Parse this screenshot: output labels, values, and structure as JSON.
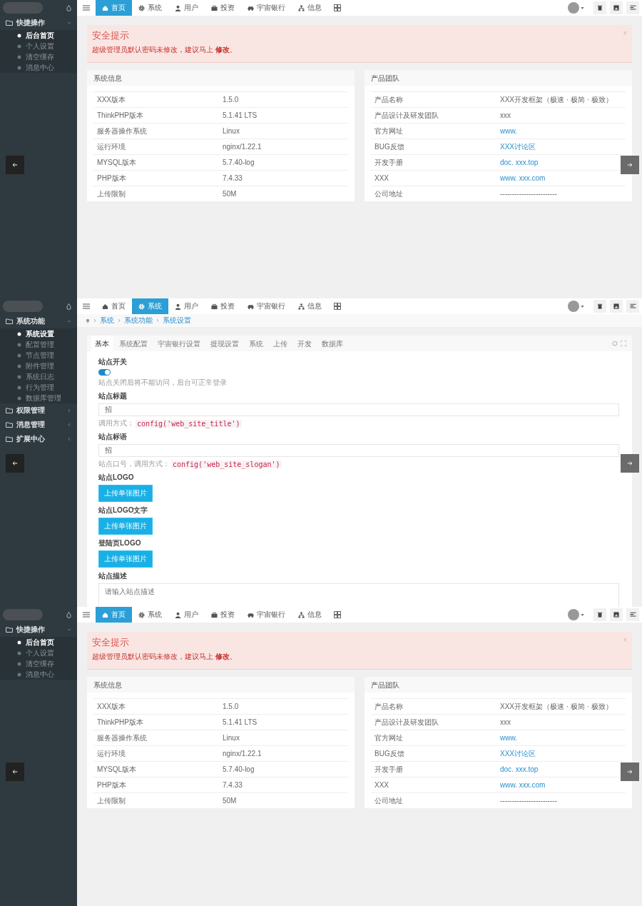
{
  "screens": [
    {
      "kind": "dashboard",
      "nav": [
        {
          "label": "首页",
          "selected": true
        },
        {
          "label": "系统",
          "selected": false
        },
        {
          "label": "用户",
          "selected": false
        },
        {
          "label": "投资",
          "selected": false
        },
        {
          "label": "宇宙银行",
          "selected": false
        },
        {
          "label": "信息",
          "selected": false
        }
      ],
      "sidebar": [
        {
          "label": "快捷操作",
          "expanded": true,
          "children": [
            {
              "label": "后台首页",
              "selected": true
            },
            {
              "label": "个人设置",
              "selected": false
            },
            {
              "label": "清空缓存",
              "selected": false
            },
            {
              "label": "消息中心",
              "selected": false
            }
          ]
        }
      ],
      "alert": {
        "title": "安全提示",
        "text": "超级管理员默认密码未修改，建议马上 **修改**。",
        "close": "×"
      },
      "panels": [
        {
          "title": "系统信息",
          "rows": [
            {
              "label": "XXX版本",
              "value": "1.5.0",
              "kind": "text"
            },
            {
              "label": "ThinkPHP版本",
              "value": "5.1.41 LTS",
              "kind": "text"
            },
            {
              "label": "服务器操作系统",
              "value": "Linux",
              "kind": "text"
            },
            {
              "label": "运行环境",
              "value": "nginx/1.22.1",
              "kind": "text"
            },
            {
              "label": "MYSQL版本",
              "value": "5.7.40-log",
              "kind": "text"
            },
            {
              "label": "PHP版本",
              "value": "7.4.33",
              "kind": "text"
            },
            {
              "label": "上传限制",
              "value": "50M",
              "kind": "text"
            }
          ]
        },
        {
          "title": "产品团队",
          "rows": [
            {
              "label": "产品名称",
              "value": "XXX开发框架（极速 · 极简 · 极致）",
              "kind": "text"
            },
            {
              "label": "产品设计及研发团队",
              "value": "xxx",
              "kind": "text"
            },
            {
              "label": "官方网址",
              "value": "www.",
              "kind": "link"
            },
            {
              "label": "BUG反馈",
              "value": "XXX讨论区",
              "kind": "link"
            },
            {
              "label": "开发手册",
              "value": "doc. xxx.top",
              "kind": "link"
            },
            {
              "label": "XXX",
              "value": "www. xxx.com",
              "kind": "link"
            },
            {
              "label": "公司地址",
              "value": "------------------------",
              "kind": "text"
            }
          ]
        }
      ]
    },
    {
      "kind": "settings",
      "nav": [
        {
          "label": "首页",
          "selected": false
        },
        {
          "label": "系统",
          "selected": true
        },
        {
          "label": "用户",
          "selected": false
        },
        {
          "label": "投资",
          "selected": false
        },
        {
          "label": "宇宙银行",
          "selected": false
        },
        {
          "label": "信息",
          "selected": false
        }
      ],
      "sidebar": [
        {
          "label": "系统功能",
          "expanded": true,
          "children": [
            {
              "label": "系统设置",
              "selected": true
            },
            {
              "label": "配置管理",
              "selected": false
            },
            {
              "label": "节点管理",
              "selected": false
            },
            {
              "label": "附件管理",
              "selected": false
            },
            {
              "label": "系统日志",
              "selected": false
            },
            {
              "label": "行为管理",
              "selected": false
            },
            {
              "label": "数据库管理",
              "selected": false
            }
          ]
        },
        {
          "label": "权限管理",
          "expanded": false
        },
        {
          "label": "消息管理",
          "expanded": false
        },
        {
          "label": "扩展中心",
          "expanded": false
        }
      ],
      "breadcrumb": [
        "系统",
        "系统功能",
        "系统设置"
      ],
      "tabs": [
        {
          "label": "基本",
          "selected": true
        },
        {
          "label": "系统配置",
          "selected": false
        },
        {
          "label": "宇宙银行设置",
          "selected": false
        },
        {
          "label": "提现设置",
          "selected": false
        },
        {
          "label": "系统",
          "selected": false
        },
        {
          "label": "上传",
          "selected": false
        },
        {
          "label": "开发",
          "selected": false
        },
        {
          "label": "数据库",
          "selected": false
        }
      ],
      "fields": [
        {
          "kind": "switch",
          "label": "站点开关",
          "on": true,
          "hint": "站点关闭后将不能访问，后台可正常登录"
        },
        {
          "kind": "text",
          "label": "站点标题",
          "value": "招",
          "hint": "调用方式：",
          "code": "config('web_site_title')"
        },
        {
          "kind": "text",
          "label": "站点标语",
          "value": "招",
          "hint": "站点口号，调用方式：",
          "code": "config('web_site_slogan')"
        },
        {
          "kind": "upload",
          "label": "站点LOGO",
          "button": "上传单张图片"
        },
        {
          "kind": "upload",
          "label": "站点LOGO文字",
          "button": "上传单张图片"
        },
        {
          "kind": "upload",
          "label": "登陆页LOGO",
          "button": "上传单张图片"
        },
        {
          "kind": "textarea",
          "label": "站点描述",
          "placeholder": "请输入站点描述"
        }
      ]
    },
    {
      "kind": "dashboard",
      "nav": [
        {
          "label": "首页",
          "selected": true
        },
        {
          "label": "系统",
          "selected": false
        },
        {
          "label": "用户",
          "selected": false
        },
        {
          "label": "投资",
          "selected": false
        },
        {
          "label": "宇宙银行",
          "selected": false
        },
        {
          "label": "信息",
          "selected": false
        }
      ],
      "sidebar": [
        {
          "label": "快捷操作",
          "expanded": true,
          "children": [
            {
              "label": "后台首页",
              "selected": true
            },
            {
              "label": "个人设置",
              "selected": false
            },
            {
              "label": "清空缓存",
              "selected": false
            },
            {
              "label": "消息中心",
              "selected": false
            }
          ]
        }
      ],
      "alert": {
        "title": "安全提示",
        "text": "超级管理员默认密码未修改，建议马上 **修改**。",
        "close": "×"
      },
      "panels": [
        {
          "title": "系统信息",
          "rows": [
            {
              "label": "XXX版本",
              "value": "1.5.0",
              "kind": "text"
            },
            {
              "label": "ThinkPHP版本",
              "value": "5.1.41 LTS",
              "kind": "text"
            },
            {
              "label": "服务器操作系统",
              "value": "Linux",
              "kind": "text"
            },
            {
              "label": "运行环境",
              "value": "nginx/1.22.1",
              "kind": "text"
            },
            {
              "label": "MYSQL版本",
              "value": "5.7.40-log",
              "kind": "text"
            },
            {
              "label": "PHP版本",
              "value": "7.4.33",
              "kind": "text"
            },
            {
              "label": "上传限制",
              "value": "50M",
              "kind": "text"
            }
          ]
        },
        {
          "title": "产品团队",
          "rows": [
            {
              "label": "产品名称",
              "value": "XXX开发框架（极速 · 极简 · 极致）",
              "kind": "text"
            },
            {
              "label": "产品设计及研发团队",
              "value": "xxx",
              "kind": "text"
            },
            {
              "label": "官方网址",
              "value": "www.",
              "kind": "link"
            },
            {
              "label": "BUG反馈",
              "value": "XXX讨论区",
              "kind": "link"
            },
            {
              "label": "开发手册",
              "value": "doc. xxx.top",
              "kind": "link"
            },
            {
              "label": "XXX",
              "value": "www. xxx.com",
              "kind": "link"
            },
            {
              "label": "公司地址",
              "value": "------------------------",
              "kind": "text"
            }
          ]
        }
      ]
    }
  ]
}
